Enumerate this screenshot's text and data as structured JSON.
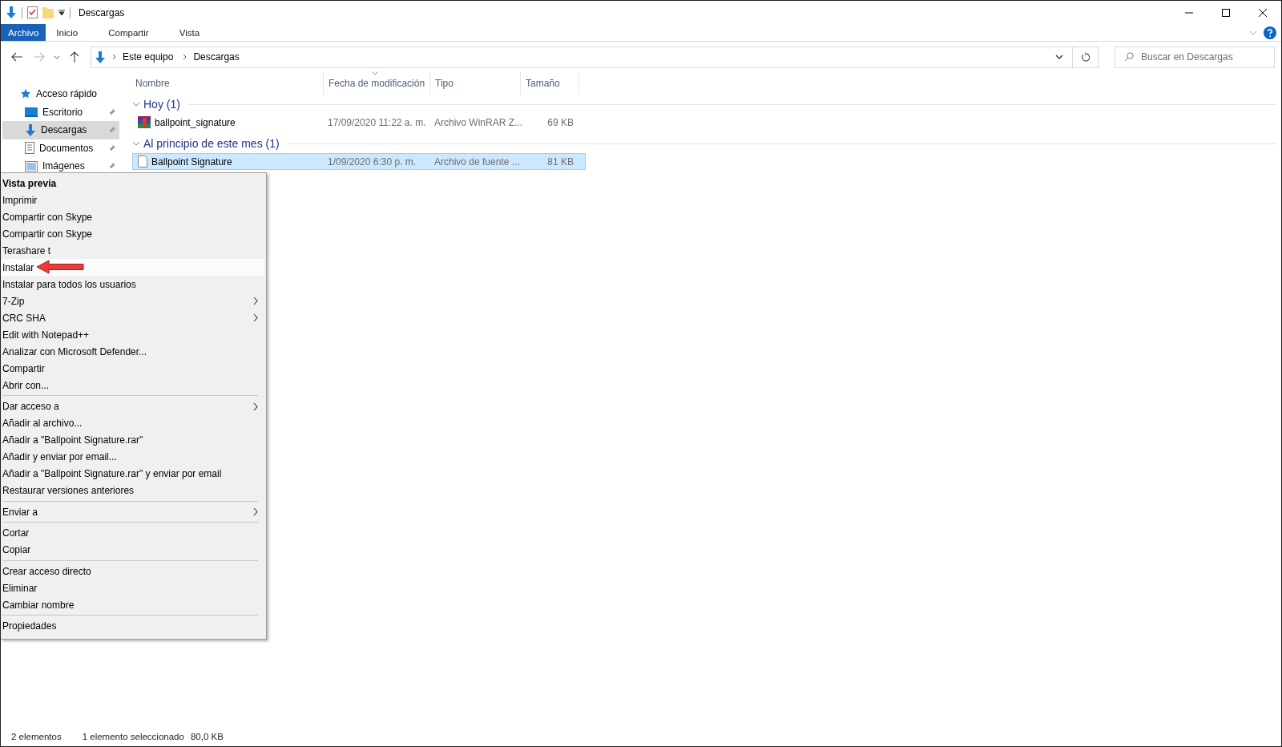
{
  "window": {
    "title": "Descargas"
  },
  "ribbon_tabs": [
    {
      "label": "Archivo",
      "kind": "file"
    },
    {
      "label": "Inicio",
      "kind": "tab"
    },
    {
      "label": "Compartir",
      "kind": "tab"
    },
    {
      "label": "Vista",
      "kind": "tab"
    }
  ],
  "address_bar": {
    "path": [
      "Este equipo",
      "Descargas"
    ]
  },
  "search": {
    "placeholder": "Buscar en Descargas"
  },
  "sidebar": {
    "items": [
      {
        "label": "Acceso rápido",
        "kind": "star",
        "selected": false,
        "children": [
          {
            "label": "Escritorio",
            "kind": "desktop",
            "selected": false,
            "pinned": true
          },
          {
            "label": "Descargas",
            "kind": "download",
            "selected": true,
            "pinned": true
          },
          {
            "label": "Documentos",
            "kind": "document",
            "selected": false,
            "pinned": true
          },
          {
            "label": "Imágenes",
            "kind": "pictures",
            "selected": false,
            "pinned": true
          }
        ]
      }
    ]
  },
  "table": {
    "columns": [
      {
        "label": "Nombre",
        "sorted": false
      },
      {
        "label": "Fecha de modificación",
        "sorted": true
      },
      {
        "label": "Tipo",
        "sorted": false
      },
      {
        "label": "Tamaño",
        "sorted": false
      }
    ],
    "groups": [
      {
        "title": "Hoy (1)",
        "rows": [
          {
            "kind": "archive",
            "selected": false,
            "cells": [
              "ballpoint_signature",
              "17/09/2020 11:22 a. m.",
              "Archivo WinRAR Z...",
              "69 KB"
            ]
          }
        ]
      },
      {
        "title": "Al principio de este mes (1)",
        "rows": [
          {
            "kind": "font",
            "selected": true,
            "cells": [
              "Ballpoint Signature",
              "1/09/2020 6:30 p. m.",
              "Archivo de fuente ...",
              "81 KB"
            ]
          }
        ]
      }
    ]
  },
  "context_menu": {
    "items": [
      {
        "kind": "item",
        "label": "Vista previa",
        "default": true,
        "highlighted": false,
        "submenu": false
      },
      {
        "kind": "item",
        "label": "Imprimir",
        "default": false,
        "highlighted": false,
        "submenu": false
      },
      {
        "kind": "item",
        "label": "Compartir con Skype",
        "default": false,
        "highlighted": false,
        "submenu": false
      },
      {
        "kind": "item",
        "label": "Compartir con Skype",
        "default": false,
        "highlighted": false,
        "submenu": false
      },
      {
        "kind": "item",
        "label": "Terashare t",
        "default": false,
        "highlighted": false,
        "submenu": false
      },
      {
        "kind": "item",
        "label": "Instalar",
        "default": false,
        "highlighted": true,
        "submenu": false
      },
      {
        "kind": "item",
        "label": "Instalar para todos los usuarios",
        "default": false,
        "highlighted": false,
        "submenu": false
      },
      {
        "kind": "item",
        "label": "7-Zip",
        "default": false,
        "highlighted": false,
        "submenu": true
      },
      {
        "kind": "item",
        "label": "CRC SHA",
        "default": false,
        "highlighted": false,
        "submenu": true
      },
      {
        "kind": "item",
        "label": "Edit with Notepad++",
        "default": false,
        "highlighted": false,
        "submenu": false
      },
      {
        "kind": "item",
        "label": "Analizar con Microsoft Defender...",
        "default": false,
        "highlighted": false,
        "submenu": false
      },
      {
        "kind": "item",
        "label": "Compartir",
        "default": false,
        "highlighted": false,
        "submenu": false
      },
      {
        "kind": "item",
        "label": "Abrir con...",
        "default": false,
        "highlighted": false,
        "submenu": false
      },
      {
        "kind": "separator"
      },
      {
        "kind": "item",
        "label": "Dar acceso a",
        "default": false,
        "highlighted": false,
        "submenu": true
      },
      {
        "kind": "item",
        "label": "Añadir al archivo...",
        "default": false,
        "highlighted": false,
        "submenu": false
      },
      {
        "kind": "item",
        "label": "Añadir a \"Ballpoint Signature.rar\"",
        "default": false,
        "highlighted": false,
        "submenu": false
      },
      {
        "kind": "item",
        "label": "Añadir y enviar por email...",
        "default": false,
        "highlighted": false,
        "submenu": false
      },
      {
        "kind": "item",
        "label": "Añadir a \"Ballpoint Signature.rar\" y enviar por email",
        "default": false,
        "highlighted": false,
        "submenu": false
      },
      {
        "kind": "item",
        "label": "Restaurar versiones anteriores",
        "default": false,
        "highlighted": false,
        "submenu": false
      },
      {
        "kind": "separator"
      },
      {
        "kind": "item",
        "label": "Enviar a",
        "default": false,
        "highlighted": false,
        "submenu": true
      },
      {
        "kind": "separator"
      },
      {
        "kind": "item",
        "label": "Cortar",
        "default": false,
        "highlighted": false,
        "submenu": false
      },
      {
        "kind": "item",
        "label": "Copiar",
        "default": false,
        "highlighted": false,
        "submenu": false
      },
      {
        "kind": "separator"
      },
      {
        "kind": "item",
        "label": "Crear acceso directo",
        "default": false,
        "highlighted": false,
        "submenu": false
      },
      {
        "kind": "item",
        "label": "Eliminar",
        "default": false,
        "highlighted": false,
        "submenu": false
      },
      {
        "kind": "item",
        "label": "Cambiar nombre",
        "default": false,
        "highlighted": false,
        "submenu": false
      },
      {
        "kind": "separator"
      },
      {
        "kind": "item",
        "label": "Propiedades",
        "default": false,
        "highlighted": false,
        "submenu": false
      }
    ]
  },
  "status_bar": {
    "count": "2 elementos",
    "selection": "1 elemento seleccionado",
    "size": "80,0 KB"
  }
}
